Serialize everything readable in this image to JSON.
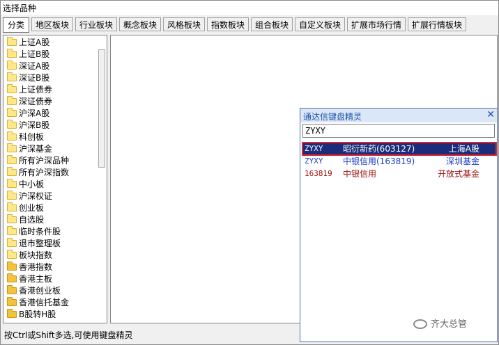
{
  "window": {
    "title": "选择品种"
  },
  "tabs": [
    {
      "label": "分类"
    },
    {
      "label": "地区板块"
    },
    {
      "label": "行业板块"
    },
    {
      "label": "概念板块"
    },
    {
      "label": "风格板块"
    },
    {
      "label": "指数板块"
    },
    {
      "label": "组合板块"
    },
    {
      "label": "自定义板块"
    },
    {
      "label": "扩展市场行情"
    },
    {
      "label": "扩展行情板块"
    }
  ],
  "tree": [
    {
      "label": "上证A股"
    },
    {
      "label": "上证B股"
    },
    {
      "label": "深证A股"
    },
    {
      "label": "深证B股"
    },
    {
      "label": "上证债券"
    },
    {
      "label": "深证债券"
    },
    {
      "label": "沪深A股"
    },
    {
      "label": "沪深B股"
    },
    {
      "label": "科创板"
    },
    {
      "label": "沪深基金"
    },
    {
      "label": "所有沪深品种"
    },
    {
      "label": "所有沪深指数"
    },
    {
      "label": "中小板"
    },
    {
      "label": "沪深权证"
    },
    {
      "label": "创业板"
    },
    {
      "label": "自选股"
    },
    {
      "label": "临时条件股"
    },
    {
      "label": "退市整理板"
    },
    {
      "label": "板块指数"
    },
    {
      "label": "香港指数"
    },
    {
      "label": "香港主板"
    },
    {
      "label": "香港创业板"
    },
    {
      "label": "香港信托基金"
    },
    {
      "label": "B股转H股"
    }
  ],
  "status": "按Ctrl或Shift多选,可使用键盘精灵",
  "keyboard_wizard": {
    "title": "通达信键盘精灵",
    "close_glyph": "✕",
    "input_value": "ZYXY",
    "results": [
      {
        "code": "ZYXY",
        "name": "昭衍新药(603127)",
        "market": "上海A股"
      },
      {
        "code": "ZYXY",
        "name": "中银信用(163819)",
        "market": "深圳基金"
      },
      {
        "code": "163819",
        "name": "中银信用",
        "market": "开放式基金"
      }
    ]
  },
  "watermark": "齐大总管"
}
